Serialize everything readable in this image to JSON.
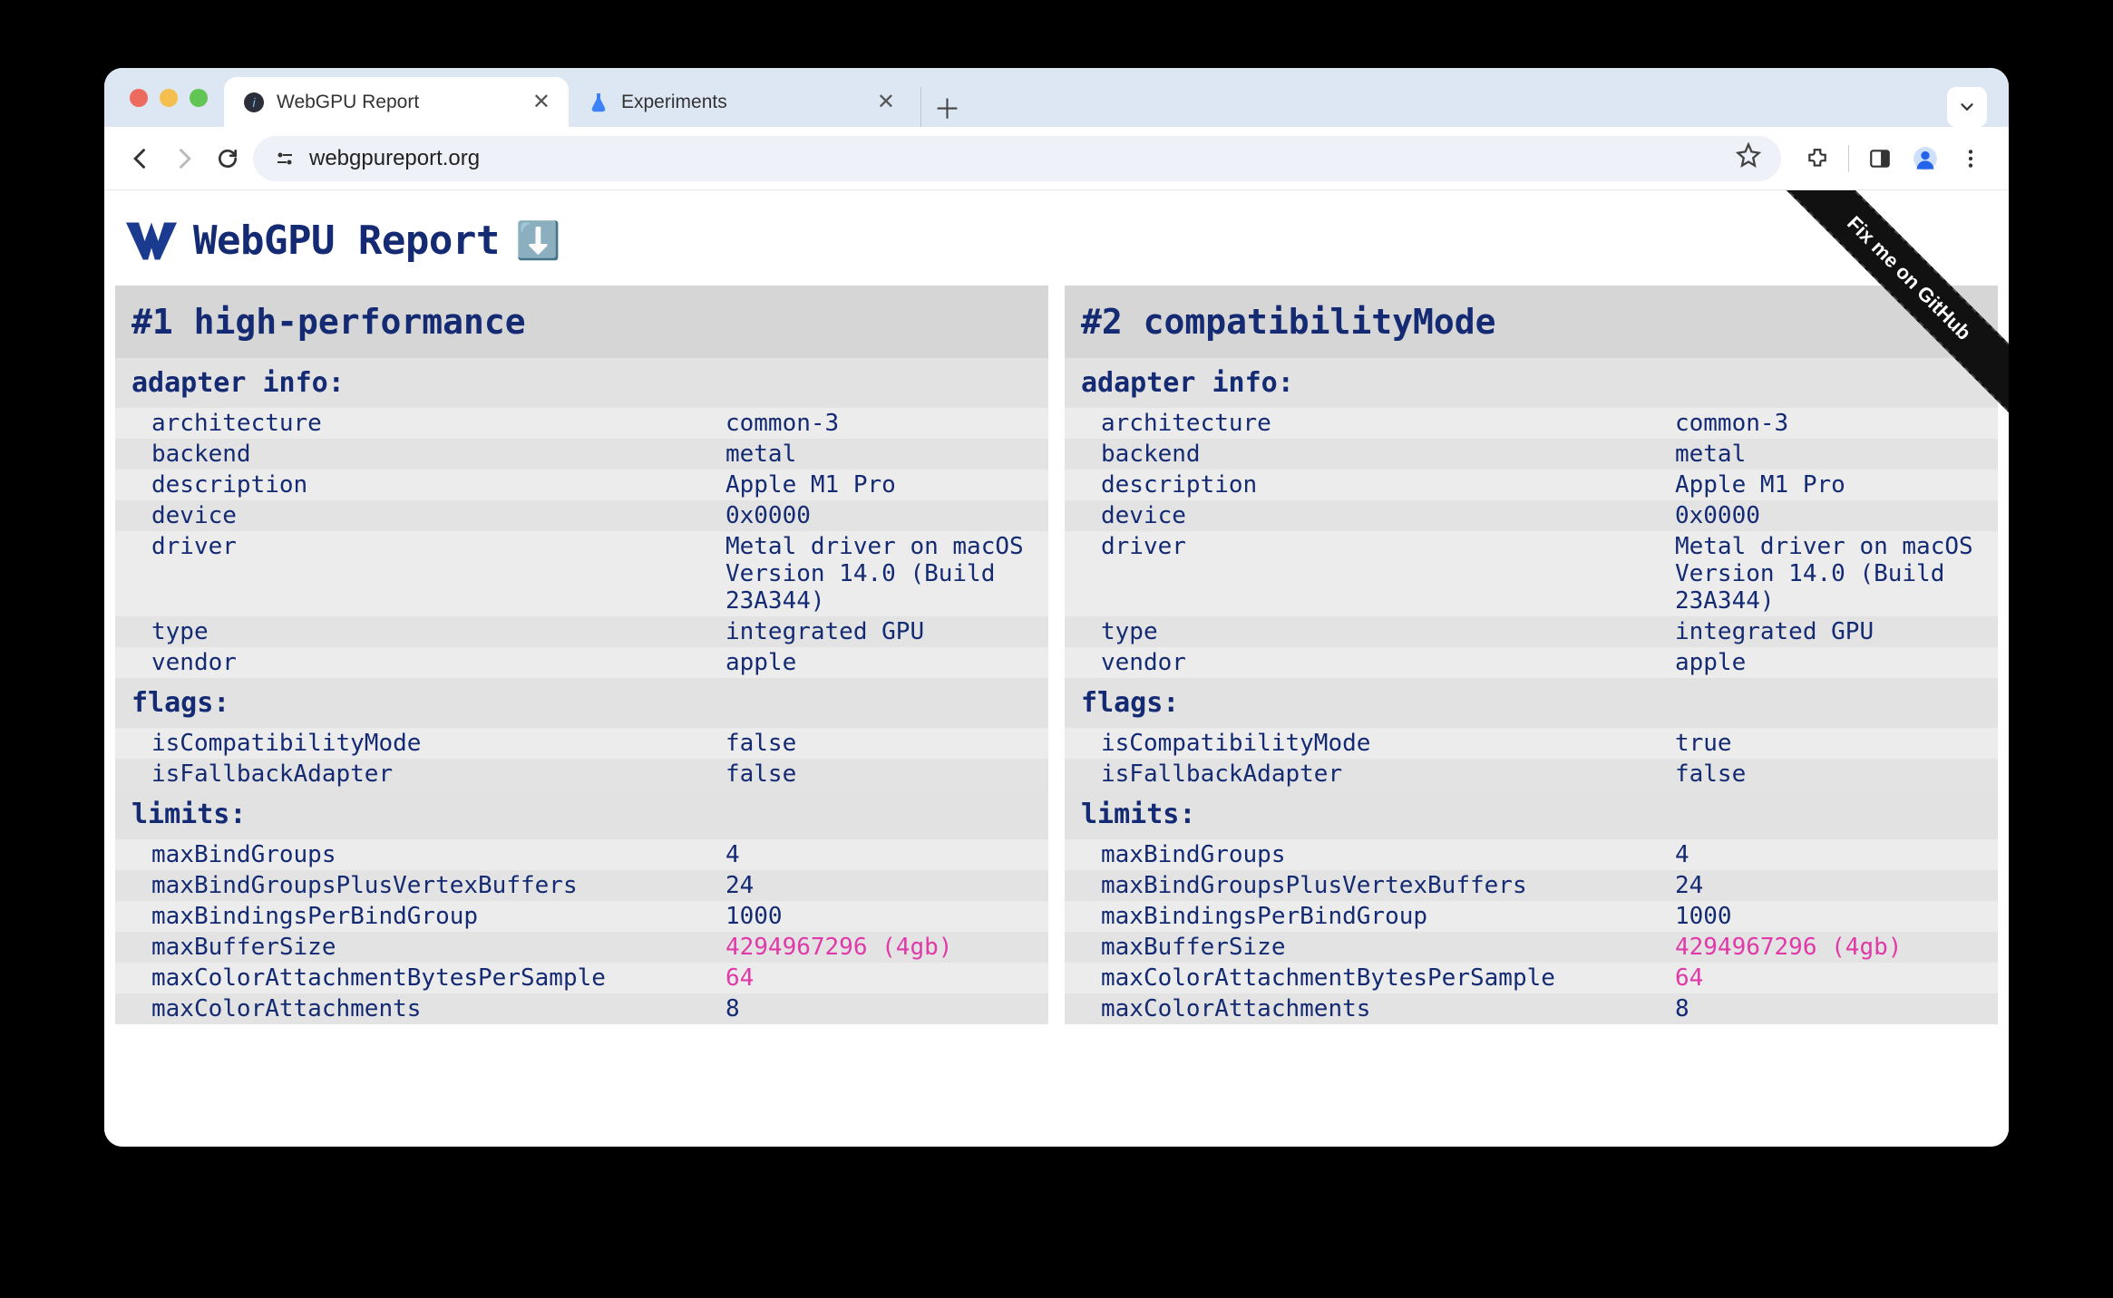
{
  "browser": {
    "tabs": [
      {
        "title": "WebGPU Report",
        "active": true
      },
      {
        "title": "Experiments",
        "active": false
      }
    ],
    "url": "webgpureport.org"
  },
  "page": {
    "title": "WebGPU Report",
    "ribbon": "Fix me on GitHub"
  },
  "panels": [
    {
      "heading": "#1 high-performance",
      "sections": [
        {
          "title": "adapter info:",
          "rows": [
            {
              "k": "architecture",
              "v": "common-3"
            },
            {
              "k": "backend",
              "v": "metal"
            },
            {
              "k": "description",
              "v": "Apple M1 Pro"
            },
            {
              "k": "device",
              "v": "0x0000"
            },
            {
              "k": "driver",
              "v": "Metal driver on macOS Version 14.0 (Build 23A344)"
            },
            {
              "k": "type",
              "v": "integrated GPU"
            },
            {
              "k": "vendor",
              "v": "apple"
            }
          ]
        },
        {
          "title": "flags:",
          "rows": [
            {
              "k": "isCompatibilityMode",
              "v": "false"
            },
            {
              "k": "isFallbackAdapter",
              "v": "false"
            }
          ]
        },
        {
          "title": "limits:",
          "rows": [
            {
              "k": "maxBindGroups",
              "v": "4"
            },
            {
              "k": "maxBindGroupsPlusVertexBuffers",
              "v": "24"
            },
            {
              "k": "maxBindingsPerBindGroup",
              "v": "1000"
            },
            {
              "k": "maxBufferSize",
              "v": "4294967296 (4gb)",
              "pink": true
            },
            {
              "k": "maxColorAttachmentBytesPerSample",
              "v": "64",
              "pink": true
            },
            {
              "k": "maxColorAttachments",
              "v": "8"
            }
          ]
        }
      ]
    },
    {
      "heading": "#2 compatibilityMode",
      "sections": [
        {
          "title": "adapter info:",
          "rows": [
            {
              "k": "architecture",
              "v": "common-3"
            },
            {
              "k": "backend",
              "v": "metal"
            },
            {
              "k": "description",
              "v": "Apple M1 Pro"
            },
            {
              "k": "device",
              "v": "0x0000"
            },
            {
              "k": "driver",
              "v": "Metal driver on macOS Version 14.0 (Build 23A344)"
            },
            {
              "k": "type",
              "v": "integrated GPU"
            },
            {
              "k": "vendor",
              "v": "apple"
            }
          ]
        },
        {
          "title": "flags:",
          "rows": [
            {
              "k": "isCompatibilityMode",
              "v": "true"
            },
            {
              "k": "isFallbackAdapter",
              "v": "false"
            }
          ]
        },
        {
          "title": "limits:",
          "rows": [
            {
              "k": "maxBindGroups",
              "v": "4"
            },
            {
              "k": "maxBindGroupsPlusVertexBuffers",
              "v": "24"
            },
            {
              "k": "maxBindingsPerBindGroup",
              "v": "1000"
            },
            {
              "k": "maxBufferSize",
              "v": "4294967296 (4gb)",
              "pink": true
            },
            {
              "k": "maxColorAttachmentBytesPerSample",
              "v": "64",
              "pink": true
            },
            {
              "k": "maxColorAttachments",
              "v": "8"
            }
          ]
        }
      ]
    }
  ]
}
